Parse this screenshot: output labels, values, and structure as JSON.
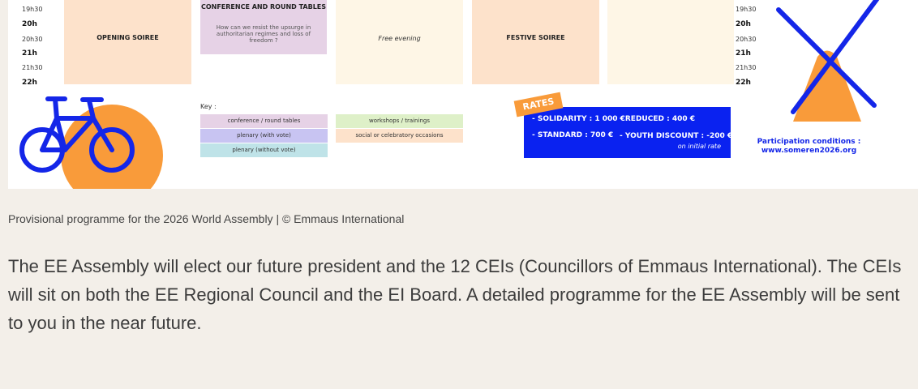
{
  "schedule": {
    "times_left": [
      "19h30",
      "20h",
      "20h30",
      "21h",
      "21h30",
      "22h"
    ],
    "times_right": [
      "19h30",
      "20h",
      "20h30",
      "21h",
      "21h30",
      "22h"
    ],
    "opening_soiree": "OPENING SOIREE",
    "conference_title": "CONFERENCE AND ROUND TABLES",
    "conference_question": "How can we resist the upsurge in authoritarian regimes and loss of freedom ?",
    "free_evening": "Free evening",
    "festive_soiree": "FESTIVE SOIREE"
  },
  "key": {
    "title": "Key :",
    "items": [
      {
        "label": "conference / round tables",
        "color": "#e6d2e6"
      },
      {
        "label": "plenary (with vote)",
        "color": "#c8c4f2"
      },
      {
        "label": "plenary (without vote)",
        "color": "#bfe3e8"
      },
      {
        "label": "workshops / trainings",
        "color": "#def0c8"
      },
      {
        "label": "social or celebratory occasions",
        "color": "#fde2cb"
      }
    ]
  },
  "rates": {
    "tag": "RATES",
    "solidarity": "- SOLIDARITY : 1 000 €",
    "reduced": "- REDUCED : 400 €",
    "standard": "- STANDARD : 700 €",
    "youth": "- YOUTH DISCOUNT : -200 €",
    "youth_note": "on initial rate"
  },
  "participation": {
    "line1": "Participation conditions :",
    "line2": "www.someren2026.org"
  },
  "caption": "Provisional programme for the 2026 World Assembly | © Emmaus International",
  "paragraph": "The EE Assembly will elect our future president and the 12 CEIs (Councillors of Emmaus International). The CEIs will sit on both the EE Regional Council and the EI Board. A detailed programme for the EE Assembly will be sent to you in the near future.",
  "colors": {
    "social": "#fde2cb",
    "free": "#fef6e6",
    "conference": "#e6d2e6",
    "rates_blue": "#0a22f0",
    "orange": "#f99b3a",
    "icon_blue": "#1426e8",
    "background": "#f3efe9"
  },
  "icons": [
    "bicycle-icon",
    "windmill-icon"
  ]
}
